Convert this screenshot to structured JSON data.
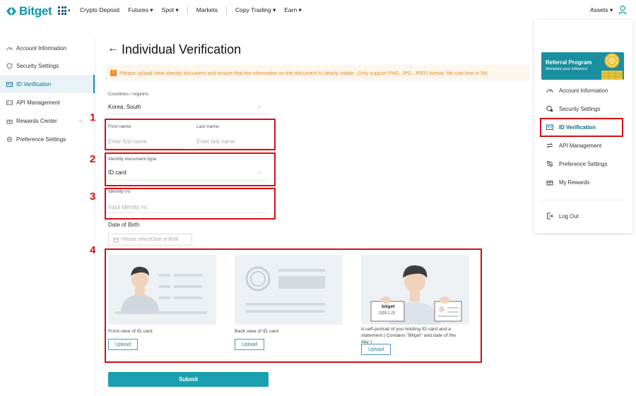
{
  "header": {
    "brand": "Bitget",
    "nav": [
      {
        "label": "Crypto Deposit"
      },
      {
        "label": "Futures ▾"
      },
      {
        "label": "Spot ▾"
      },
      {
        "label": "Markets"
      },
      {
        "label": "Copy Trading ▾"
      },
      {
        "label": "Earn ▾"
      }
    ],
    "assets": "Assets ▾"
  },
  "sidebar": {
    "items": [
      {
        "label": "Account Information",
        "icon": "speedometer-icon"
      },
      {
        "label": "Security Settings",
        "icon": "shield-icon"
      },
      {
        "label": "ID Verification",
        "icon": "id-card-icon",
        "active": true
      },
      {
        "label": "API Management",
        "icon": "api-icon"
      },
      {
        "label": "Rewards Center",
        "icon": "gift-icon"
      },
      {
        "label": "Preference Settings",
        "icon": "gear-icon"
      }
    ]
  },
  "page": {
    "title": "Individual Verification",
    "notice": "Please upload clear identity document and ensure that the information on the document is clearly visible ; Only support PNG, JPG, JPEG format, file size limit is 2M"
  },
  "form": {
    "country_label": "Countries / regions",
    "country_value": "Korea, South",
    "first_name_label": "First name",
    "first_name_placeholder": "Enter first name",
    "last_name_label": "Last name",
    "last_name_placeholder": "Enter last name",
    "doc_type_label": "Identity document type",
    "doc_type_value": "ID card",
    "id_no_label": "Identity no",
    "id_no_placeholder": "Input identity no.",
    "dob_label": "Date of Birth",
    "dob_placeholder": "Please selectDate of Birth",
    "front_caption": "Front view of ID card",
    "back_caption": "Back view of ID card",
    "selfie_caption": "A self-portrait of you holding ID card and a statement ( Contains \"Bitget\" and date of the day )",
    "upload_label": "Upload",
    "submit_label": "Submit",
    "selfie_card_brand": "bitget",
    "selfie_card_date": "2020.1.23"
  },
  "annotations": {
    "n1": "1",
    "n2": "2",
    "n3": "3",
    "n4": "4"
  },
  "dropdown": {
    "banner_title": "Referral Program",
    "banner_subtitle": "Monetize your influence",
    "items": [
      {
        "label": "Account Information"
      },
      {
        "label": "Security Settings"
      },
      {
        "label": "ID Verification",
        "active": true
      },
      {
        "label": "API Management"
      },
      {
        "label": "Preference Settings"
      },
      {
        "label": "My Rewards"
      }
    ],
    "logout": "Log Out"
  },
  "colors": {
    "accent": "#0b96ad",
    "annotation": "#d40e14",
    "notice": "#e88a2d",
    "submit": "#1aa0b0"
  }
}
